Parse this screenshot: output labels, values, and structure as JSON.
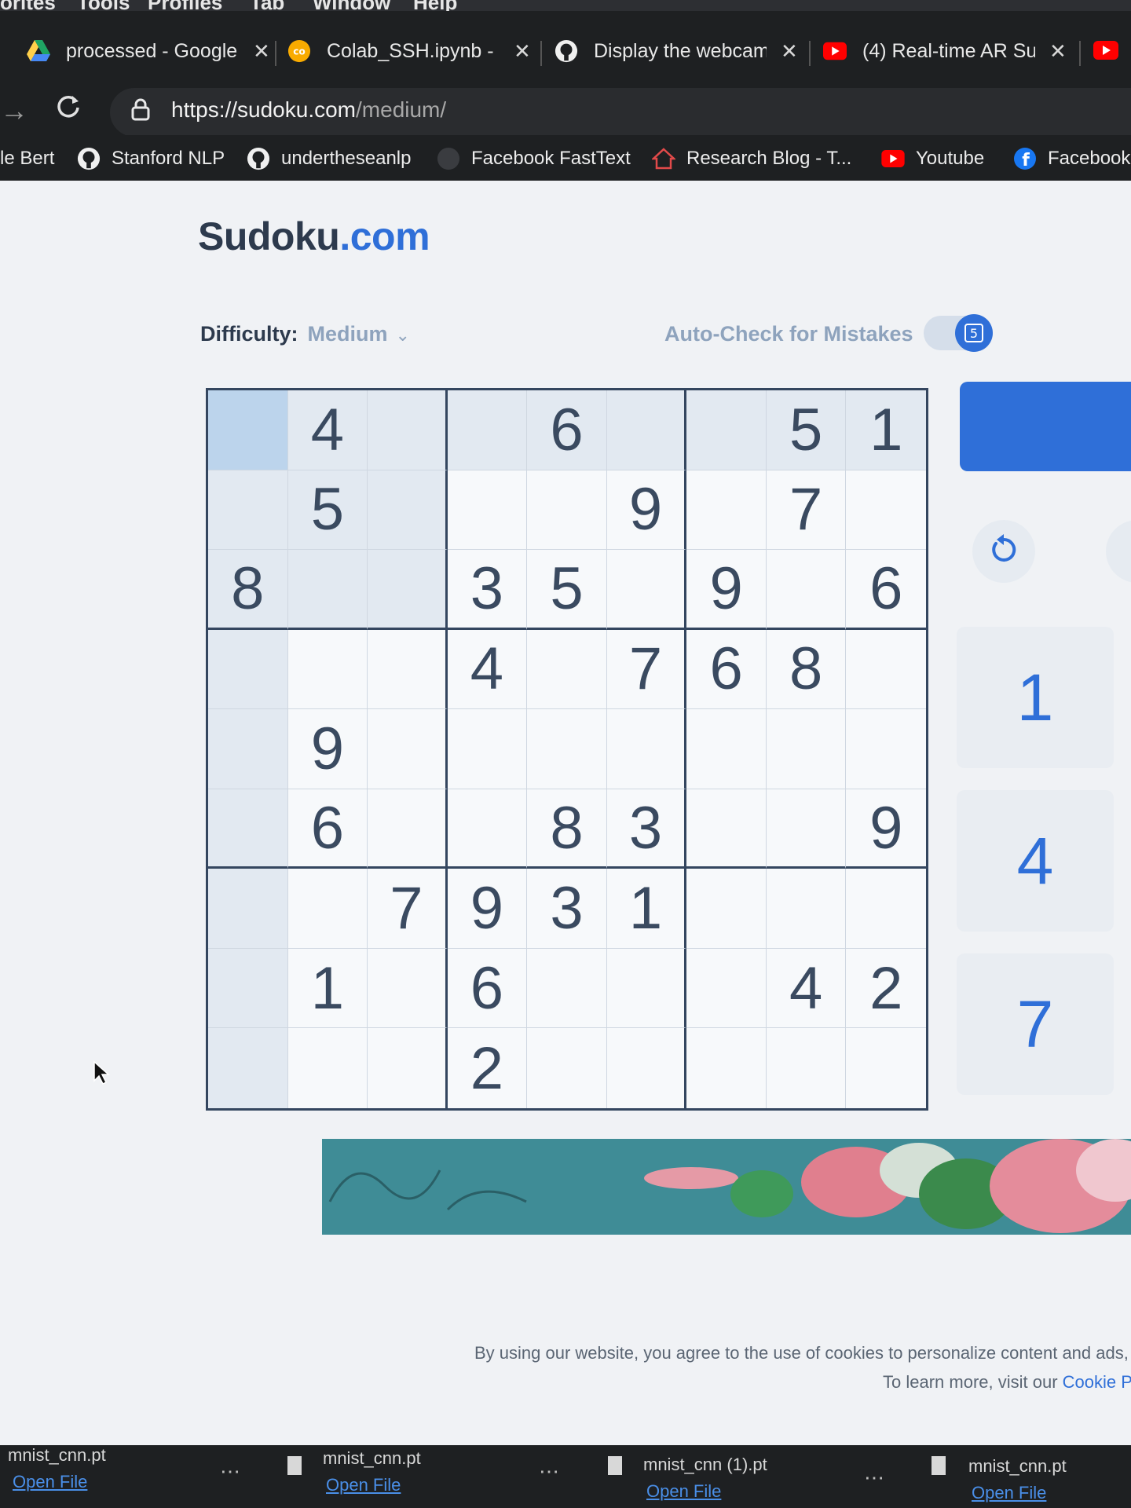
{
  "browser": {
    "menu": [
      "orites",
      "Tools",
      "Profiles",
      "Tab",
      "Window",
      "Help"
    ],
    "tabs": [
      {
        "title": "processed - Google",
        "icon": "google-drive-icon"
      },
      {
        "title": "Colab_SSH.ipynb - C",
        "icon": "colab-icon"
      },
      {
        "title": "Display the webcam",
        "icon": "github-icon"
      },
      {
        "title": "(4) Real-time AR Su",
        "icon": "youtube-icon"
      }
    ],
    "url_host": "https://sudoku.com",
    "url_path": "/medium/",
    "bookmarks": [
      {
        "label": "le Bert",
        "icon": ""
      },
      {
        "label": "Stanford NLP",
        "icon": "github-icon"
      },
      {
        "label": "undertheseanlp",
        "icon": "github-icon"
      },
      {
        "label": "Facebook FastText",
        "icon": "github-icon"
      },
      {
        "label": "Research Blog - T...",
        "icon": "home-icon"
      },
      {
        "label": "Youtube",
        "icon": "youtube-icon"
      },
      {
        "label": "Facebook",
        "icon": "facebook-icon"
      }
    ],
    "colors": {
      "chrome_dark": "#1e2022",
      "accent": "#2f6fd8"
    }
  },
  "page": {
    "logo_main": "Sudoku",
    "logo_tld": ".com",
    "difficulty_label": "Difficulty:",
    "difficulty_value": "Medium",
    "autocheck_label": "Auto-Check for Mistakes",
    "autocheck_badge": "5",
    "grid": [
      [
        "",
        "4",
        "",
        "",
        "6",
        "",
        "",
        "5",
        "1"
      ],
      [
        "",
        "5",
        "",
        "",
        "",
        "9",
        "",
        "7",
        ""
      ],
      [
        "8",
        "",
        "",
        "3",
        "5",
        "",
        "9",
        "",
        "6"
      ],
      [
        "",
        "",
        "",
        "4",
        "",
        "7",
        "6",
        "8",
        ""
      ],
      [
        "",
        "9",
        "",
        "",
        "",
        "",
        "",
        "",
        ""
      ],
      [
        "",
        "6",
        "",
        "",
        "8",
        "3",
        "",
        "",
        "9"
      ],
      [
        "",
        "",
        "7",
        "9",
        "3",
        "1",
        "",
        "",
        ""
      ],
      [
        "",
        "1",
        "",
        "6",
        "",
        "",
        "",
        "4",
        "2"
      ],
      [
        "",
        "",
        "",
        "2",
        "",
        "",
        "",
        "",
        ""
      ]
    ],
    "numpad": [
      "1",
      "4",
      "7"
    ],
    "cookie_line1": "By using our website, you agree to the use of cookies to personalize content and ads, to",
    "cookie_line2_prefix": "To learn more, visit our ",
    "cookie_link": "Cookie P"
  },
  "downloads": [
    {
      "name": "mnist_cnn.pt",
      "action": "Open File"
    },
    {
      "name": "mnist_cnn.pt",
      "action": "Open File"
    },
    {
      "name": "mnist_cnn (1).pt",
      "action": "Open File"
    },
    {
      "name": "mnist_cnn.pt",
      "action": "Open File"
    }
  ]
}
